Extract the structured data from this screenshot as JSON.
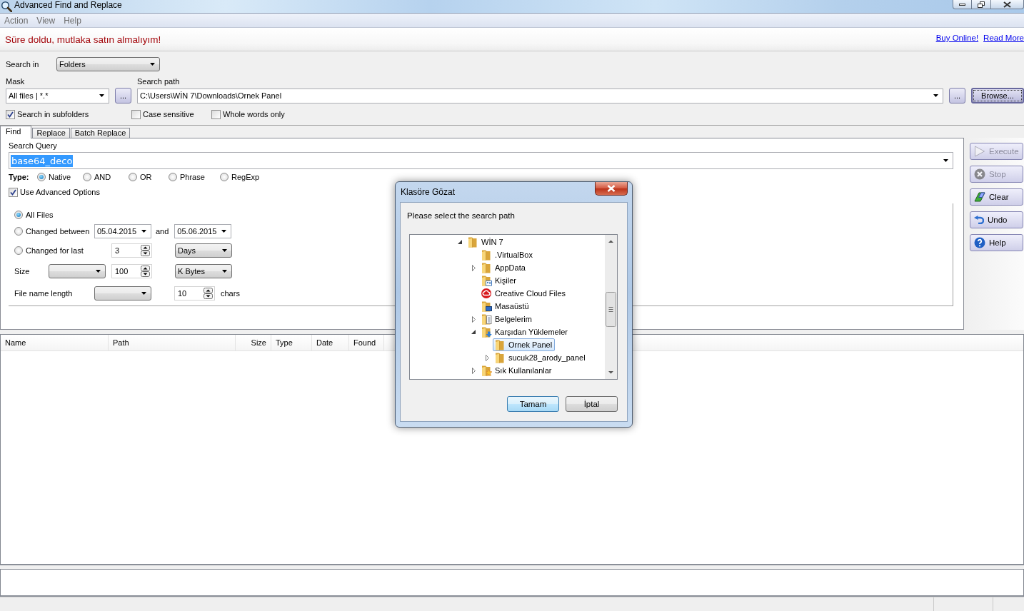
{
  "window": {
    "title": "Advanced Find and Replace"
  },
  "menu": [
    {
      "label": "Action"
    },
    {
      "label": "View"
    },
    {
      "label": "Help"
    }
  ],
  "banner": {
    "message": "Süre doldu, mutlaka satın almalıyım!",
    "links": [
      "Buy Online!",
      "Read More"
    ]
  },
  "search_in": {
    "label": "Search in",
    "value": "Folders"
  },
  "mask": {
    "label": "Mask",
    "value": "All files | *.*",
    "button": "..."
  },
  "search_path": {
    "label": "Search path",
    "value": "C:\\Users\\WİN 7\\Downloads\\Ornek Panel",
    "button": "...",
    "browse_button": "Browse..."
  },
  "search_options": [
    {
      "label": "Search in subfolders",
      "checked": true
    },
    {
      "label": "Case sensitive",
      "checked": false
    },
    {
      "label": "Whole words only",
      "checked": false
    }
  ],
  "tabs": [
    {
      "label": "Find",
      "selected": true
    },
    {
      "label": "Replace",
      "selected": false
    },
    {
      "label": "Batch Replace",
      "selected": false
    }
  ],
  "find": {
    "query_label": "Search Query",
    "query": {
      "value": "base64_deco",
      "highlighted": true
    },
    "type_label": "Type:",
    "types": [
      {
        "label": "Native",
        "selected": true
      },
      {
        "label": "AND",
        "selected": false
      },
      {
        "label": "OR",
        "selected": false
      },
      {
        "label": "Phrase",
        "selected": false
      },
      {
        "label": "RegExp",
        "selected": false
      }
    ],
    "advanced": {
      "label": "Use Advanced Options",
      "checked": true
    },
    "date_filters": [
      {
        "kind": "all",
        "label": "All Files",
        "selected": true
      },
      {
        "kind": "between",
        "label": "Changed between",
        "selected": false,
        "from": "05.04.2015",
        "joiner": "and",
        "to": "05.06.2015"
      },
      {
        "kind": "last",
        "label": "Changed for last",
        "selected": false,
        "amount": "3",
        "unit": "Days"
      }
    ],
    "size": {
      "label": "Size",
      "amount": "100",
      "unit": "K Bytes"
    },
    "name_length": {
      "label": "File name length",
      "amount": "10",
      "unit": "chars"
    }
  },
  "actions": [
    {
      "label": "Execute",
      "disabled": true
    },
    {
      "label": "Stop",
      "disabled": true
    },
    {
      "label": "Clear",
      "disabled": false
    },
    {
      "label": "Undo",
      "disabled": false
    },
    {
      "label": "Help",
      "disabled": false
    }
  ],
  "results": {
    "columns": [
      "Name",
      "Path",
      "Size",
      "Type",
      "Date",
      "Found"
    ]
  },
  "dialog": {
    "title": "Klasöre Gözat",
    "prompt": "Please select the search path",
    "tree": [
      {
        "label": "WİN 7",
        "kind": "folder",
        "expanded": true,
        "selected": false,
        "children": [
          {
            "label": ".VirtualBox",
            "kind": "folder",
            "selected": false
          },
          {
            "label": "AppData",
            "kind": "folder",
            "expanded": false,
            "selected": false
          },
          {
            "label": "Kişiler",
            "kind": "contacts",
            "selected": false
          },
          {
            "label": "Creative Cloud Files",
            "kind": "cloud",
            "selected": false
          },
          {
            "label": "Masaüstü",
            "kind": "desktop",
            "selected": false
          },
          {
            "label": "Belgelerim",
            "kind": "documents",
            "expanded": false,
            "selected": false
          },
          {
            "label": "Karşıdan Yüklemeler",
            "kind": "downloads",
            "expanded": true,
            "selected": false,
            "children": [
              {
                "label": "Ornek Panel",
                "kind": "folder",
                "selected": true
              },
              {
                "label": "sucuk28_arody_panel",
                "kind": "folder",
                "expanded": false,
                "selected": false
              }
            ]
          },
          {
            "label": "Sık Kullanılanlar",
            "kind": "favorites",
            "expanded": false,
            "selected": false
          }
        ]
      }
    ],
    "buttons": [
      {
        "label": "Tamam",
        "default": true
      },
      {
        "label": "İptal",
        "default": false
      }
    ]
  }
}
